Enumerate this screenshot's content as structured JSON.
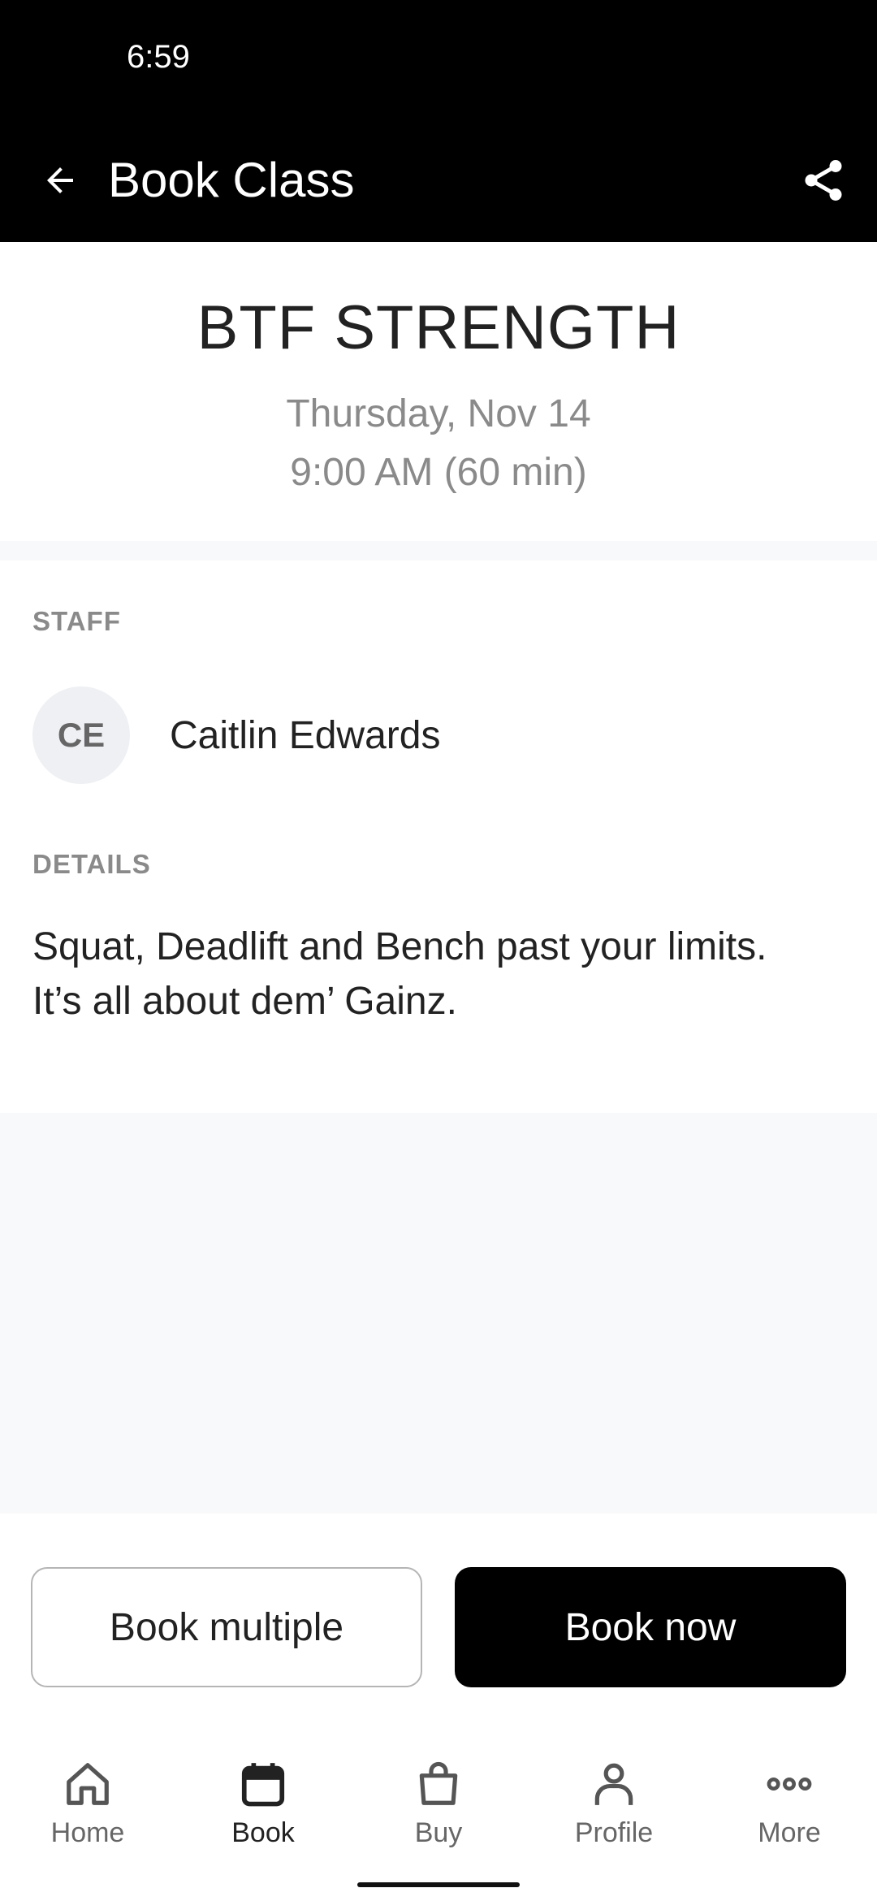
{
  "status_bar": {
    "time": "6:59"
  },
  "app_bar": {
    "title": "Book Class"
  },
  "class_info": {
    "name": "BTF STRENGTH",
    "date": "Thursday, Nov 14",
    "time": "9:00 AM (60 min)"
  },
  "staff": {
    "section_label": "STAFF",
    "initials": "CE",
    "name": "Caitlin Edwards"
  },
  "details": {
    "section_label": "DETAILS",
    "line1": "Squat, Deadlift and Bench past your limits.",
    "line2": "It’s all about dem’ Gainz."
  },
  "actions": {
    "book_multiple": "Book multiple",
    "book_now": "Book now"
  },
  "bottom_nav": {
    "active": "Book",
    "items": [
      {
        "label": "Home",
        "icon": "home-icon"
      },
      {
        "label": "Book",
        "icon": "calendar-icon"
      },
      {
        "label": "Buy",
        "icon": "shopping-bag-icon"
      },
      {
        "label": "Profile",
        "icon": "person-icon"
      },
      {
        "label": "More",
        "icon": "more-dots-icon"
      }
    ]
  },
  "colors": {
    "app_bar_bg": "#000000",
    "primary_button": "#000000",
    "muted_text": "#8a8a8a",
    "page_bg": "#f8f9fb"
  }
}
